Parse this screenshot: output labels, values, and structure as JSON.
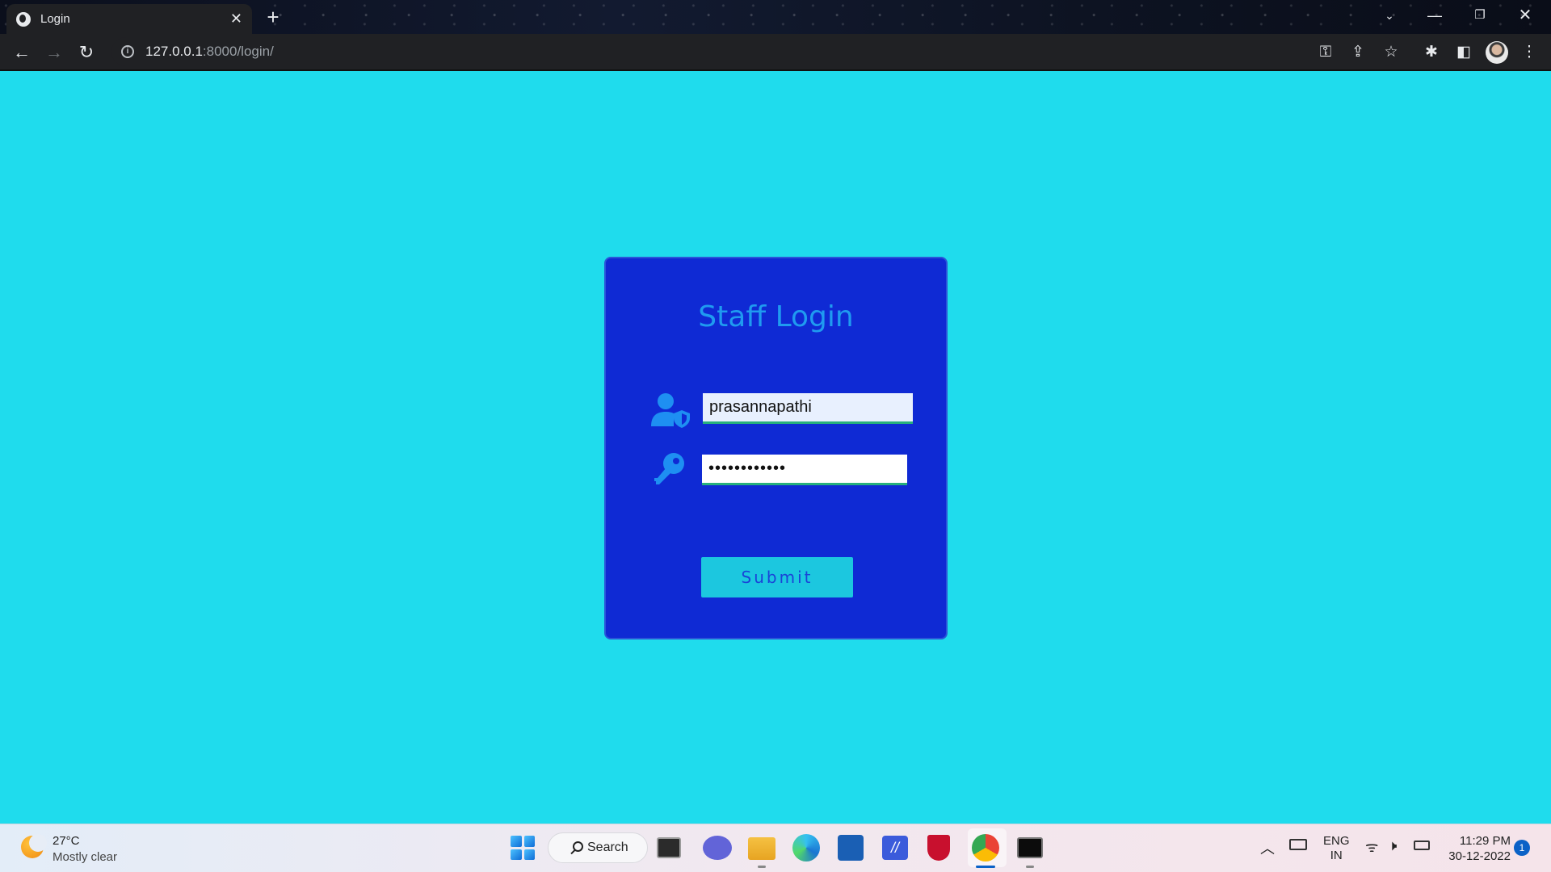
{
  "browser": {
    "tab_title": "Login",
    "url_host": "127.0.0.1",
    "url_path": ":8000/login/"
  },
  "login": {
    "title": "Staff Login",
    "username_value": "prasannapathi",
    "password_value": "••••••••••••",
    "submit_label": "Submit"
  },
  "colors": {
    "page_bg": "#1fdced",
    "card_bg": "#0f2ad4",
    "title": "#1f9bf0",
    "button_bg": "#1cc7df",
    "button_text": "#1a44d8"
  },
  "taskbar": {
    "weather_temp": "27°C",
    "weather_desc": "Mostly clear",
    "search_label": "Search",
    "lang_line1": "ENG",
    "lang_line2": "IN",
    "time": "11:29 PM",
    "date": "30-12-2022",
    "notification_count": "1"
  }
}
